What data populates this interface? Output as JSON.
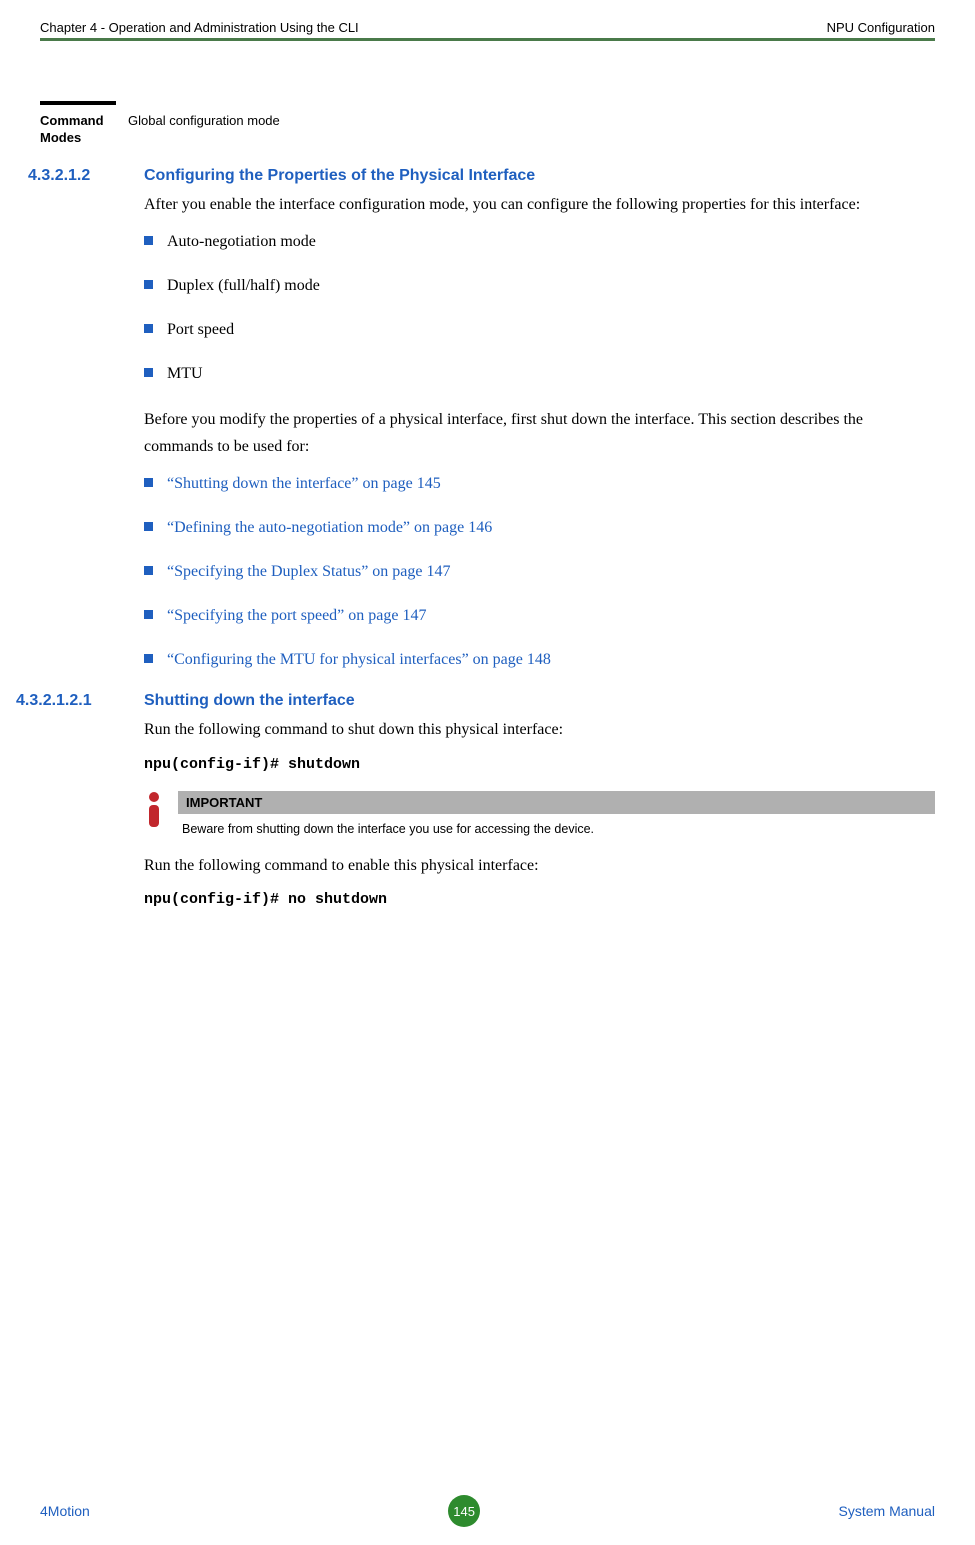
{
  "header": {
    "left": "Chapter 4 - Operation and Administration Using the CLI",
    "right": "NPU Configuration"
  },
  "commandModes": {
    "label": "Command Modes",
    "value": "Global configuration mode"
  },
  "section1": {
    "num": "4.3.2.1.2",
    "title": "Configuring the Properties of the Physical Interface",
    "intro": "After you enable the interface configuration mode, you can configure the following properties for this interface:",
    "bullets": [
      "Auto-negotiation mode",
      "Duplex (full/half) mode",
      "Port speed",
      "MTU"
    ],
    "para2": "Before you modify the properties of a physical interface, first shut down the interface. This section describes the commands to be used for:",
    "links": [
      "“Shutting down the interface” on page 145",
      "“Defining the auto-negotiation mode” on page 146",
      "“Specifying the Duplex Status” on page 147",
      "“Specifying the port speed” on page 147",
      "“Configuring the MTU for physical interfaces” on page 148"
    ]
  },
  "section2": {
    "num": "4.3.2.1.2.1",
    "title": "Shutting down the interface",
    "intro": "Run the following command to shut down this physical interface:",
    "code1": "npu(config-if)# shutdown",
    "importantLabel": "IMPORTANT",
    "importantText": "Beware from shutting down the interface you use for accessing the device.",
    "para2": "Run the following command to enable this physical interface:",
    "code2": "npu(config-if)# no shutdown"
  },
  "footer": {
    "left": "4Motion",
    "page": "145",
    "right": "System Manual"
  }
}
